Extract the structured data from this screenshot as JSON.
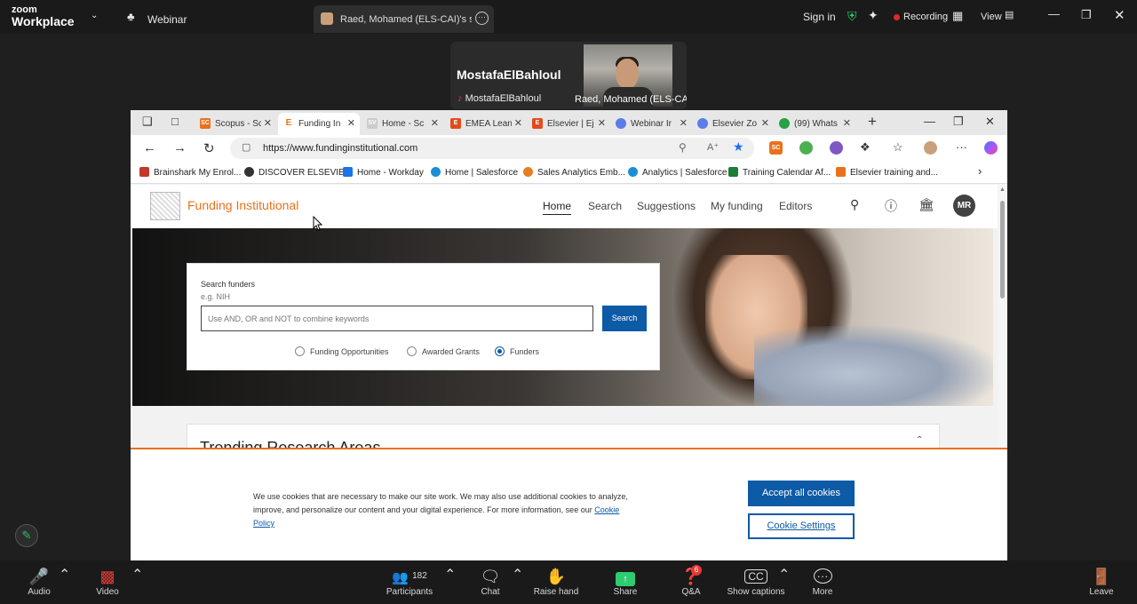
{
  "zoom": {
    "brand_line1": "zoom",
    "brand_line2": "Workplace",
    "webinar_label": "Webinar",
    "share_tab_title": "Raed, Mohamed (ELS-CAI)'s scree",
    "sign_in": "Sign in",
    "recording_label": "Recording",
    "view_label": "View"
  },
  "participants": {
    "tile1_name": "MostafaElBahloul",
    "tile1_label": "MostafaElBahloul",
    "tile2_label": "Raed, Mohamed (ELS-CAI)"
  },
  "browser": {
    "tabs": [
      {
        "label": "Scopus - Sc",
        "fav": "SC",
        "color": "#e9711c"
      },
      {
        "label": "Funding In",
        "fav": "E",
        "color": "#e9711c"
      },
      {
        "label": "Home - Sc",
        "fav": "SV",
        "color": "#bbbbbb"
      },
      {
        "label": "EMEA Lean",
        "fav": "E",
        "color": "#e34b1c"
      },
      {
        "label": "Elsevier | Ej",
        "fav": "E",
        "color": "#e34b1c"
      },
      {
        "label": "Webinar Ir",
        "fav": "",
        "color": "#5a7de8"
      },
      {
        "label": "Elsevier Zo",
        "fav": "",
        "color": "#5a7de8"
      },
      {
        "label": "(99) Whats",
        "fav": "",
        "color": "#25a244"
      }
    ],
    "url": "https://www.fundinginstitutional.com",
    "bookmarks": [
      {
        "label": "Brainshark My Enrol...",
        "color": "#c0392b"
      },
      {
        "label": "DISCOVER ELSEVIER",
        "color": "#333333"
      },
      {
        "label": "Home - Workday",
        "color": "#1a73e8"
      },
      {
        "label": "Home | Salesforce",
        "color": "#1a8fd6"
      },
      {
        "label": "Sales Analytics Emb...",
        "color": "#e67e22"
      },
      {
        "label": "Analytics | Salesforce",
        "color": "#1a8fd6"
      },
      {
        "label": "Training Calendar Af...",
        "color": "#1e7e34"
      },
      {
        "label": "Elsevier training and...",
        "color": "#e9711c"
      }
    ]
  },
  "site": {
    "name": "Funding Institutional",
    "nav": [
      "Home",
      "Search",
      "Suggestions",
      "My funding",
      "Editors"
    ],
    "avatar_initials": "MR",
    "search": {
      "label": "Search funders",
      "example": "e.g. NIH",
      "placeholder": "Use AND, OR and NOT to combine keywords",
      "button": "Search",
      "options": [
        "Funding Opportunities",
        "Awarded Grants",
        "Funders"
      ],
      "selected": "Funders"
    },
    "trending_title": "Trending Research Areas",
    "cookie": {
      "text": "We use cookies that are necessary to make our site work. We may also use additional cookies to analyze, improve, and personalize our content and your digital experience. For more information, see our",
      "link1": "Cookie",
      "link2": "Policy",
      "accept": "Accept all cookies",
      "settings": "Cookie Settings"
    }
  },
  "toolbar": {
    "audio": "Audio",
    "video": "Video",
    "participants": "Participants",
    "participant_count": "182",
    "chat": "Chat",
    "raise_hand": "Raise hand",
    "share": "Share",
    "qa": "Q&A",
    "qa_badge": "6",
    "captions": "Show captions",
    "more": "More",
    "leave": "Leave"
  },
  "colors": {
    "brand_orange": "#e9711c",
    "primary_blue": "#0d5aa7",
    "zoom_dark": "#1a1a1a",
    "recording_red": "#e02828",
    "share_green": "#2ecc71"
  }
}
